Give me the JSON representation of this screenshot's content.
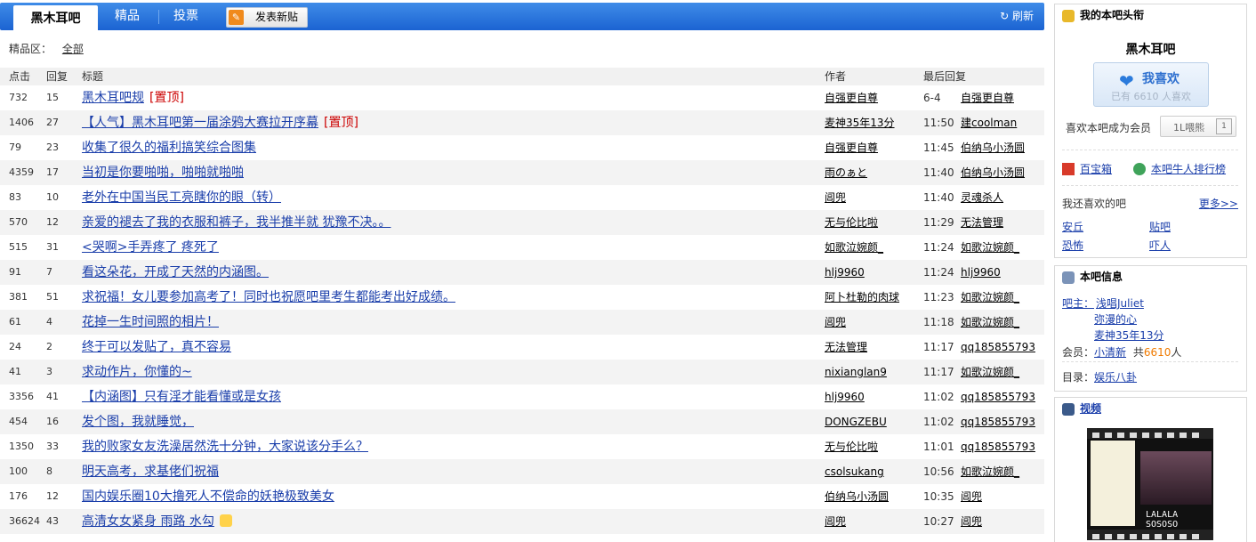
{
  "tabs": {
    "active": "黑木耳吧",
    "t2": "精品",
    "t3": "投票",
    "new_post": "发表新贴",
    "refresh": "刷新"
  },
  "filter": {
    "label": "精品区：",
    "all": "全部"
  },
  "columns": {
    "clicks": "点击",
    "replies": "回复",
    "title": "标题",
    "author": "作者",
    "last": "最后回复"
  },
  "sticky_label": "置顶",
  "threads": [
    {
      "clicks": "732",
      "replies": "15",
      "title": "黑木耳吧规",
      "sticky": true,
      "author": "自强更自尊",
      "time": "6-4",
      "last": "自强更自尊"
    },
    {
      "clicks": "1406",
      "replies": "27",
      "title": "【人气】黑木耳吧第一届涂鸦大赛拉开序幕",
      "sticky": true,
      "author": "麦神35年13分",
      "time": "11:50",
      "last": "建coolman"
    },
    {
      "clicks": "79",
      "replies": "23",
      "title": "收集了很久的福利搞笑综合图集",
      "author": "自强更自尊",
      "time": "11:45",
      "last": "伯纳乌小汤圆"
    },
    {
      "clicks": "4359",
      "replies": "17",
      "title": "当初是你要啪啪，啪啪就啪啪",
      "author": "雨のぁと",
      "time": "11:40",
      "last": "伯纳乌小汤圆"
    },
    {
      "clicks": "83",
      "replies": "10",
      "title": "老外在中国当民工亮瞎你的眼（转）",
      "author": "阊兜",
      "time": "11:40",
      "last": "灵魂杀人"
    },
    {
      "clicks": "570",
      "replies": "12",
      "title": "亲爱的褪去了我的衣服和裤子，我半推半就 犹豫不决。。",
      "author": "无与伦比啦",
      "time": "11:29",
      "last": "无法管理"
    },
    {
      "clicks": "515",
      "replies": "31",
      "title": "<哭啊>手弄疼了 疼死了",
      "author": "如歌泣婉颜_",
      "time": "11:24",
      "last": "如歌泣婉颜_"
    },
    {
      "clicks": "91",
      "replies": "7",
      "title": "看这朵花，开成了天然的内涵图。",
      "author": "hlj9960",
      "time": "11:24",
      "last": "hlj9960"
    },
    {
      "clicks": "381",
      "replies": "51",
      "title": "求祝福！女儿要参加高考了！同时也祝愿吧里考生都能考出好成绩。",
      "author": "阿卜杜勒的肉球",
      "time": "11:23",
      "last": "如歌泣婉颜_"
    },
    {
      "clicks": "61",
      "replies": "4",
      "title": "花掉一生时间照的相片！",
      "author": "阊兜",
      "time": "11:18",
      "last": "如歌泣婉颜_"
    },
    {
      "clicks": "24",
      "replies": "2",
      "title": "终于可以发贴了，真不容易",
      "author": "无法管理",
      "time": "11:17",
      "last": "qq185855793"
    },
    {
      "clicks": "41",
      "replies": "3",
      "title": "求动作片，你懂的~",
      "author": "nixianglan9",
      "time": "11:17",
      "last": "如歌泣婉颜_"
    },
    {
      "clicks": "3356",
      "replies": "41",
      "title": "【内涵图】只有淫才能看懂或是女孩",
      "author": "hlj9960",
      "time": "11:02",
      "last": "qq185855793"
    },
    {
      "clicks": "454",
      "replies": "16",
      "title": "发个图，我就睡觉，",
      "author": "DONGZEBU",
      "time": "11:02",
      "last": "qq185855793"
    },
    {
      "clicks": "1350",
      "replies": "33",
      "title": "我的败家女友洗澡居然洗十分钟，大家说该分手么？",
      "author": "无与伦比啦",
      "time": "11:01",
      "last": "qq185855793"
    },
    {
      "clicks": "100",
      "replies": "8",
      "title": "明天高考，求基佬们祝福",
      "author": "csolsukang",
      "time": "10:56",
      "last": "如歌泣婉颜_"
    },
    {
      "clicks": "176",
      "replies": "12",
      "title": "国内娱乐圈10大撸死人不偿命的妖艳极致美女",
      "author": "伯纳乌小汤圆",
      "time": "10:35",
      "last": "阊兜"
    },
    {
      "clicks": "36624",
      "replies": "43",
      "title": "高清女女紧身 雨路 水勾",
      "thumb": true,
      "author": "阊兜",
      "time": "10:27",
      "last": "阊兜"
    }
  ],
  "side": {
    "head_title": "我的本吧头衔",
    "forum_name": "黑木耳吧",
    "like_label": "我喜欢",
    "like_count": "已有 6610 人喜欢",
    "member_text": "喜欢本吧成为会员",
    "level_text": "1L喂熊",
    "level_badge": "1",
    "tool1": "百宝箱",
    "tool2": "本吧牛人排行榜",
    "also_like": "我还喜欢的吧",
    "more": "更多>>",
    "forums": [
      "安丘",
      "贴吧",
      "恐怖",
      "吓人"
    ],
    "info_title": "本吧信息",
    "owner_label": "吧主：",
    "owners": [
      "浅唱Juliet",
      "弥漫的心",
      "麦神35年13分"
    ],
    "members_label": "会员：",
    "members_name": "小清新",
    "members_total_pre": "共",
    "members_total": "6610",
    "members_total_post": "人",
    "dir_label": "目录：",
    "dir_value": "娱乐八卦",
    "video_title": "视频",
    "video_caption": "LALALA SOSOSO",
    "colors": {
      "tab_bar": "#1b63d2",
      "link": "#1a3eaa",
      "sticky": "#cc0000",
      "like_blue": "#2d6fcf",
      "count_orange": "#f07a00"
    }
  }
}
